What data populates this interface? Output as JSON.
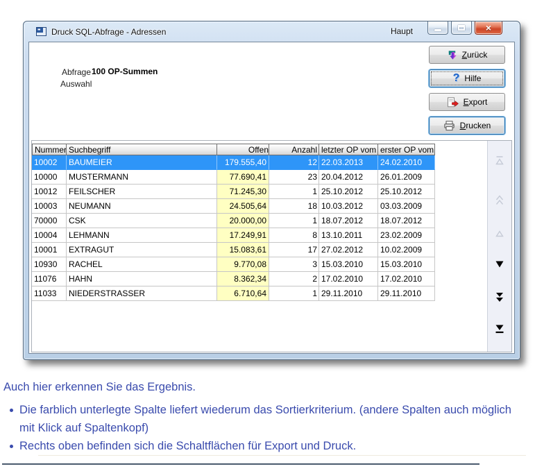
{
  "window": {
    "title": "Druck SQL-Abfrage - Adressen",
    "haupt_label": "Haupt",
    "controls": [
      "minimize-icon",
      "maximize-icon",
      "close-icon"
    ],
    "close_glyph": "×"
  },
  "query_info": {
    "abfrage_label": "Abfrage",
    "abfrage_value": "100 OP-Summen",
    "auswahl_label": "Auswahl"
  },
  "action_buttons": [
    {
      "id": "zurueck",
      "u": "Z",
      "rest": "urück",
      "icon": "exit-icon"
    },
    {
      "id": "hilfe",
      "u": "",
      "rest": "Hilfe",
      "icon": "help-icon"
    },
    {
      "id": "export",
      "u": "E",
      "rest": "xport",
      "icon": "export-icon"
    },
    {
      "id": "drucken",
      "u": "D",
      "rest": "rucken",
      "icon": "printer-icon"
    }
  ],
  "table": {
    "columns": [
      "Nummer",
      "Suchbegriff",
      "Offen",
      "Anzahl",
      "letzter OP vom",
      "erster OP vom"
    ],
    "sort_column": "Offen",
    "sort_highlight_color": "#ffffc2",
    "selected_row_color": "#2e95f8",
    "rows": [
      {
        "selected": true,
        "cells": [
          "10002",
          "BAUMEIER",
          "179.555,40",
          "12",
          "22.03.2013",
          "24.02.2010"
        ]
      },
      {
        "selected": false,
        "cells": [
          "10000",
          "MUSTERMANN",
          "77.690,41",
          "23",
          "20.04.2012",
          "26.01.2009"
        ]
      },
      {
        "selected": false,
        "cells": [
          "10012",
          "FEILSCHER",
          "71.245,30",
          "1",
          "25.10.2012",
          "25.10.2012"
        ]
      },
      {
        "selected": false,
        "cells": [
          "10003",
          "NEUMANN",
          "24.505,64",
          "18",
          "10.03.2012",
          "03.03.2009"
        ]
      },
      {
        "selected": false,
        "cells": [
          "70000",
          "CSK",
          "20.000,00",
          "1",
          "18.07.2012",
          "18.07.2012"
        ]
      },
      {
        "selected": false,
        "cells": [
          "10004",
          "LEHMANN",
          "17.249,91",
          "8",
          "13.10.2011",
          "23.02.2009"
        ]
      },
      {
        "selected": false,
        "cells": [
          "10001",
          "EXTRAGUT",
          "15.083,61",
          "17",
          "27.02.2012",
          "10.02.2009"
        ]
      },
      {
        "selected": false,
        "cells": [
          "10930",
          "RACHEL",
          "9.770,08",
          "3",
          "15.03.2010",
          "15.03.2010"
        ]
      },
      {
        "selected": false,
        "cells": [
          "11076",
          "HAHN",
          "8.362,34",
          "2",
          "17.02.2010",
          "17.02.2010"
        ]
      },
      {
        "selected": false,
        "cells": [
          "11033",
          "NIEDERSTRASSER",
          "6.710,64",
          "1",
          "29.11.2010",
          "29.11.2010"
        ]
      }
    ]
  },
  "nav_strip": {
    "buttons": [
      {
        "name": "scroll-top-icon",
        "enabled": false
      },
      {
        "name": "scroll-page-up-icon",
        "enabled": false
      },
      {
        "name": "scroll-up-icon",
        "enabled": false
      },
      {
        "name": "scroll-down-icon",
        "enabled": true
      },
      {
        "name": "scroll-page-down-icon",
        "enabled": true
      },
      {
        "name": "scroll-bottom-icon",
        "enabled": true
      }
    ]
  },
  "notes": {
    "intro": "Auch hier erkennen Sie das Ergebnis.",
    "bullets": [
      "Die farblich unterlegte Spalte liefert wiederum das Sortierkriterium. (andere Spalten auch möglich mit Klick auf Spaltenkopf)",
      "Rechts oben befinden sich die Schaltflächen für Export und Druck."
    ],
    "text_color": "#3a4bad"
  }
}
